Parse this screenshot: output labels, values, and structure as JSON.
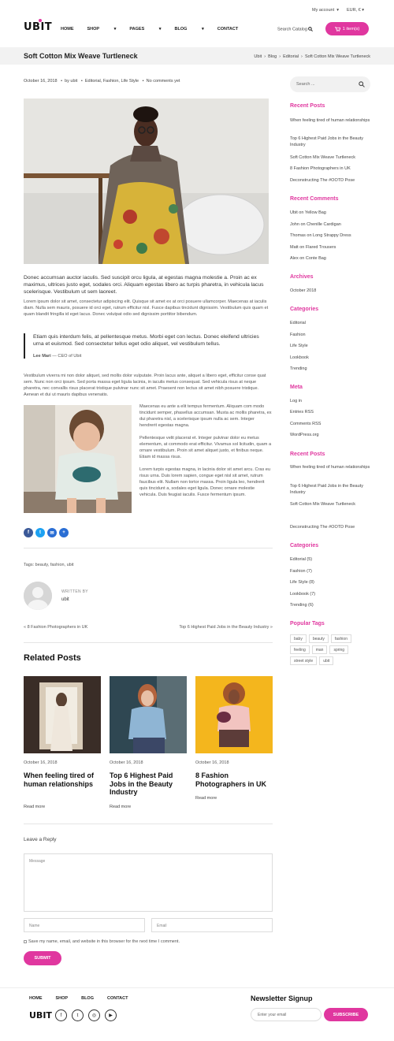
{
  "topbar": {
    "account": "My account",
    "currency": "EUR, €"
  },
  "header": {
    "logo": "UBIT",
    "nav": [
      "HOME",
      "SHOP",
      "PAGES",
      "BLOG",
      "CONTACT"
    ],
    "search_label": "Search Catalog",
    "cart_label": "1 item(s)"
  },
  "titlebar": {
    "title": "Soft Cotton Mix Weave Turtleneck",
    "breadcrumb": [
      "Ubit",
      "Blog",
      "Editorial",
      "Soft Cotton Mix Weave Turtleneck"
    ]
  },
  "post": {
    "date": "October 16, 2018",
    "by": "by ubit",
    "categories": "Editorial, Fashion, Life Style",
    "comments": "No comments yet",
    "lead": "Donec accumsan auctor iaculis. Sed suscipit orcu ligula, at egestas magna molestie a. Proin ac ex maximus, ultrices justo eget, sodales orci. Aliquam egestas libero ac turpis pharetra, in vehicula lacus scelerisque. Vestibulum ut sem laoreet.",
    "para1": "Lorem ipsum dolor sit amet, consectetur adipiscing elit. Quisque sit amet ex at orci posuere ullamcorper. Maecenas at iaculis diam. Nulla sem mauris, posuere id orci eget, rutrum efficitur nisl. Fusce dapibus tincidunt dignissim. Vestibulum quis quam et quam blandit fringilla id eget lacus. Donec volutpat odio sed dignissim porttitor bibendum.",
    "quote": "Etiam quis interdum felis, at pellentesque metus. Morbi eget con lectus. Donec eleifend ultricies urna et euismod. Sed consectetur tellus eget odio aliquet, vel vestibulum tellus.",
    "quote_author": "Lee Mari",
    "quote_role": "— CEO of Ubit",
    "para2": "Vestibulum viverra mi non dolor aliquet, sed mollis dolor vulputate. Proin lacus ante, aliquet a libero eget, efficitur conse quat sem. Nunc non orci ipsum. Sed porta massa eget ligula lacinia, in iaculis metus consequat. Sed vehicula risus at neque pharetra, nec convallis risus placerat tristique pulvinar nunc sit amet. Praesent non lectus sit amet nibh posuere tristique. Aenean et dui ut mauris dapibus venenatis.",
    "side1": "Maecenas eu ante a elit tempus fermentum. Aliquam com modo tincidunt semper, phasellus accumsan. Musta ac mollis pharetra, ex dui pharetra nisl, a scelerisque ipsum nulla ac sem. Integer hendrerit egestas magna.",
    "side2": "Pellentesque velit placerat et. Integer pulvinar dolor eu metus elementum, at commodo erat efficitur. Vivamus sol licitudin, quam a ornare vestibulum. Proin sit amet aliquet justo, et finibus neque. Etiam id massa risus.",
    "side3": "Lorem turpis egestas magna, in lacinia dolor sit amet arcu. Cras eu risus urna. Duis lorem sapien, congue eget nisl sit amet, rutrum faucibus elit. Nullam non tortor massa. Proin ligula leo, hendrerit quis tincidunt a, sodales eget ligula. Donec ornare molestie vehicula. Duis feugiat iaculis. Fusce fermentum ipsum.",
    "tags": "Tags: beauty, fashion, ubit",
    "written_by": "WRITTEN BY",
    "author": "ubit",
    "prev": "« 8 Fashion Photographers in UK",
    "next": "Top 6 Highest Paid Jobs in the Beauty Industry »"
  },
  "related": {
    "heading": "Related Posts",
    "items": [
      {
        "date": "October 16, 2018",
        "title": "When feeling tired of human relationships",
        "more": "Read more"
      },
      {
        "date": "October 16, 2018",
        "title": "Top 6 Highest Paid Jobs in the Beauty Industry",
        "more": "Read more"
      },
      {
        "date": "October 16, 2018",
        "title": "8 Fashion Photographers in UK",
        "more": "Read more"
      }
    ]
  },
  "reply": {
    "heading": "Leave a Reply",
    "message_placeholder": "Message",
    "name_placeholder": "Name",
    "email_placeholder": "Email",
    "cookie_text": "Save my name, email, and website in this browser for the next time I comment.",
    "submit": "SUBMIT"
  },
  "sidebar": {
    "search_placeholder": "Search ...",
    "recent_posts_h": "Recent Posts",
    "recent_posts": [
      "When feeling tired of human relationships",
      "Top 6 Highest Paid Jobs in the Beauty Industry",
      "Soft Cotton Mix Weave Turtleneck",
      "8 Fashion Photographers in UK",
      "Deconstructing The #OOTD Pose"
    ],
    "recent_comments_h": "Recent Comments",
    "recent_comments": [
      "Ubit on Yellow Bag",
      "John on Chenille Cardigan",
      "Thomas on Long Strappy Dress",
      "Matt on Flared Trousers",
      "Alex on Conte Bag"
    ],
    "archives_h": "Archives",
    "archives": [
      "October 2018"
    ],
    "categories_h": "Categories",
    "categories": [
      "Editorial",
      "Fashion",
      "Life Style",
      "Lookbook",
      "Trending"
    ],
    "meta_h": "Meta",
    "meta": [
      "Log in",
      "Entries RSS",
      "Comments RSS",
      "WordPress.org"
    ],
    "recent_posts2_h": "Recent Posts",
    "recent_posts2": [
      "When feeling tired of human relationships",
      "Top 6 Highest Paid Jobs in the Beauty Industry",
      "Soft Cotton Mix Weave Turtleneck",
      "Deconstructing The #OOTD Pose"
    ],
    "categories2_h": "Categories",
    "categories2": [
      "Editorial (5)",
      "Fashion (7)",
      "Life Style (8)",
      "Lookbook (7)",
      "Trending (6)"
    ],
    "popular_tags_h": "Popular Tags",
    "popular_tags": [
      "baby",
      "beauty",
      "fashion",
      "feeling",
      "man",
      "spring",
      "street style",
      "ubit"
    ]
  },
  "footer": {
    "nav": [
      "HOME",
      "SHOP",
      "BLOG",
      "CONTACT"
    ],
    "logo": "UBIT",
    "newsletter_h": "Newsletter Signup",
    "email_placeholder": "Enter your email",
    "subscribe": "SUBSCRIBE"
  },
  "colors": {
    "accent": "#e0379f"
  },
  "icons": {
    "cart": "cart-icon",
    "search": "search-icon",
    "facebook": "facebook-icon",
    "twitter": "twitter-icon",
    "email": "email-icon",
    "share": "plus-icon",
    "instagram": "instagram-icon",
    "youtube": "youtube-icon"
  }
}
